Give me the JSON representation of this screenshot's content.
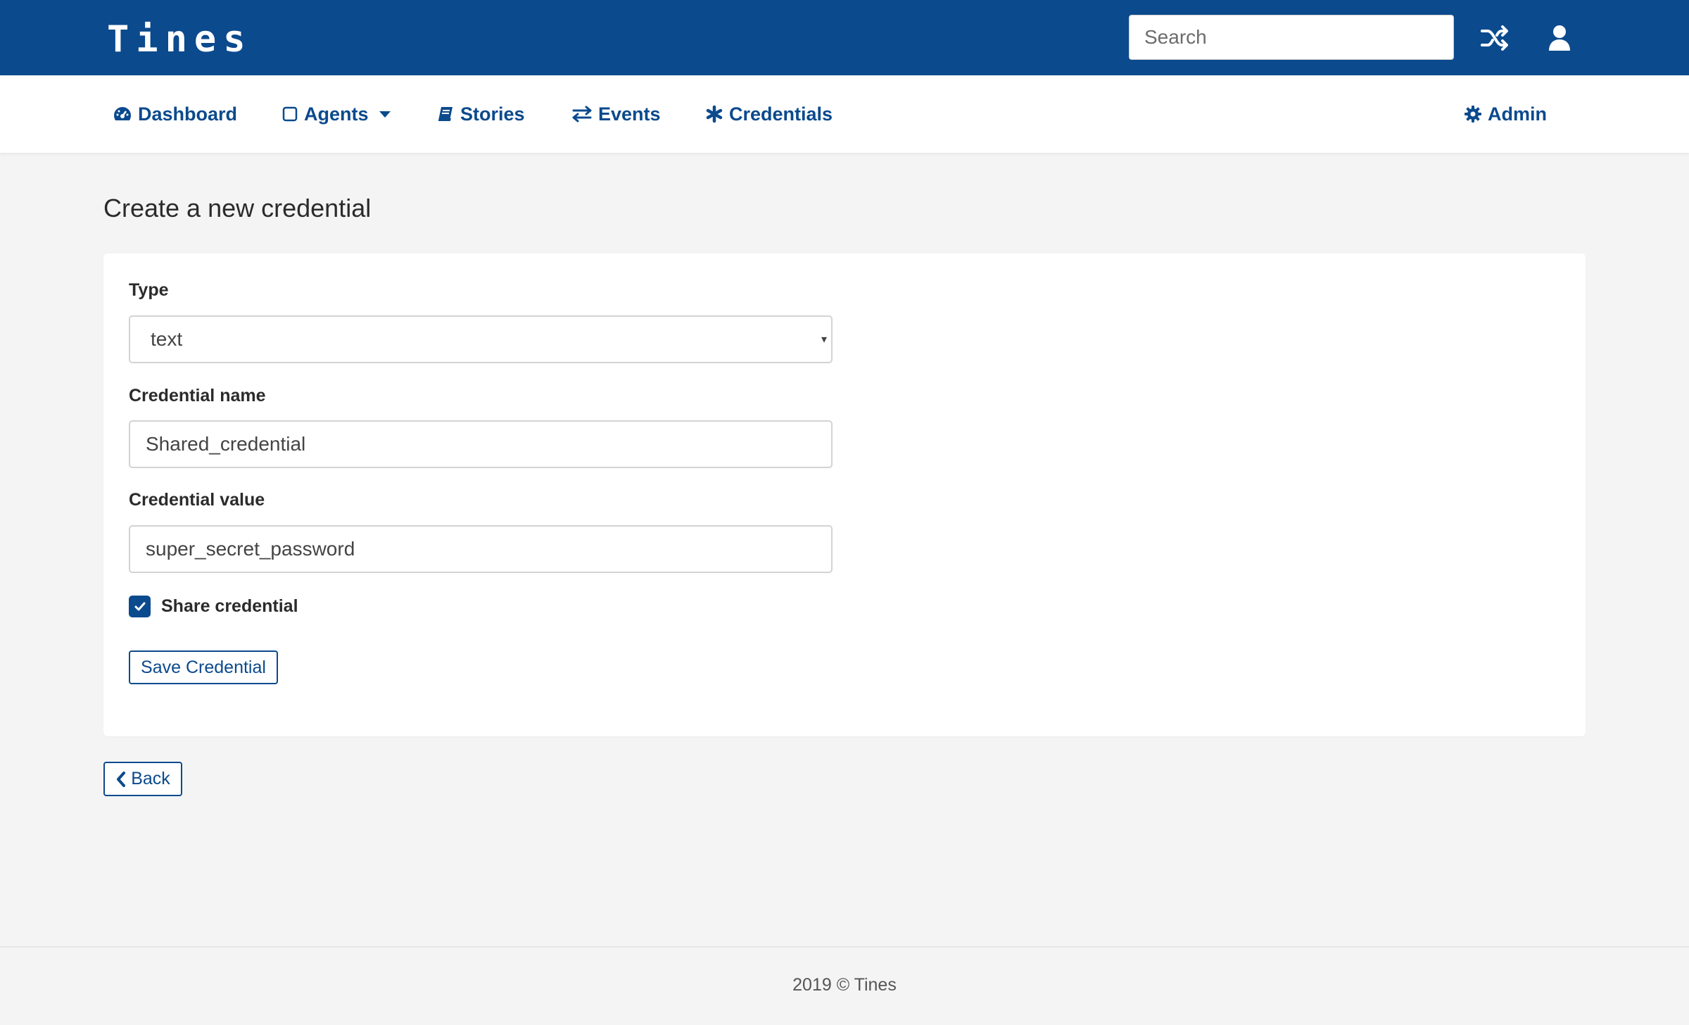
{
  "header": {
    "logo": "Tines",
    "search_placeholder": "Search"
  },
  "nav": {
    "dashboard": "Dashboard",
    "agents": "Agents",
    "stories": "Stories",
    "events": "Events",
    "credentials": "Credentials",
    "admin": "Admin"
  },
  "page": {
    "title": "Create a new credential"
  },
  "form": {
    "type_label": "Type",
    "type_value": "text",
    "name_label": "Credential name",
    "name_value": "Shared_credential",
    "value_label": "Credential value",
    "value_value": "super_secret_password",
    "share_label": "Share credential",
    "share_checked": true,
    "save_label": "Save Credential"
  },
  "back_label": "Back",
  "footer": {
    "text": "2019 © Tines"
  },
  "colors": {
    "brand": "#0b4a8d",
    "background": "#f4f4f4"
  },
  "icons": [
    "dashboard-icon",
    "square-icon",
    "caret-down-icon",
    "book-icon",
    "exchange-icon",
    "asterisk-icon",
    "gear-icon",
    "shuffle-icon",
    "user-icon",
    "check-icon",
    "chevron-left-icon"
  ]
}
